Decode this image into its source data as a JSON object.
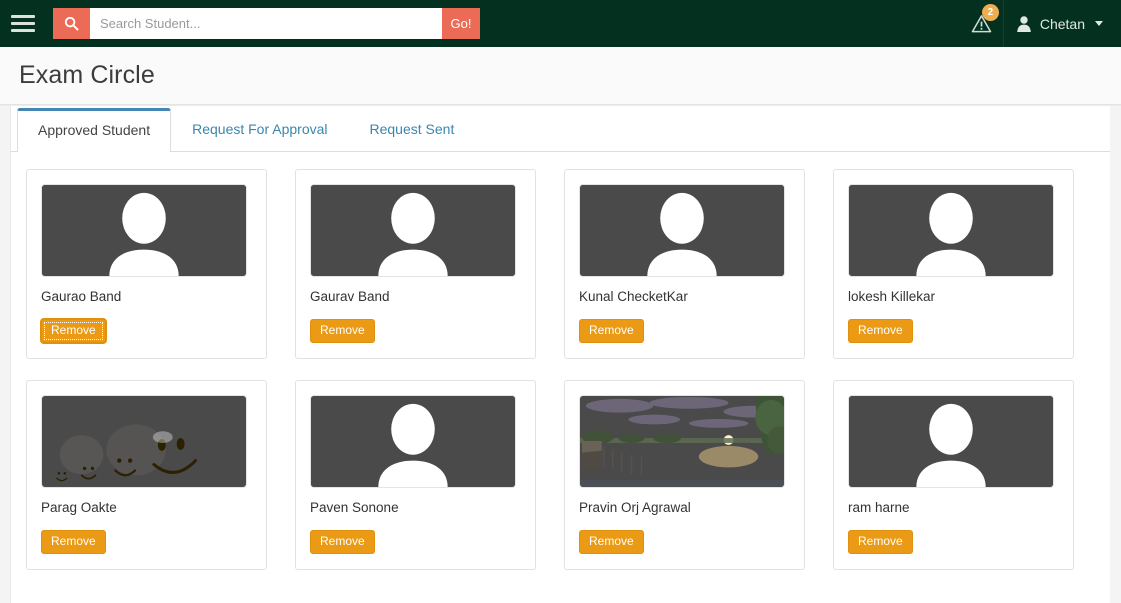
{
  "navbar": {
    "menu_icon": "hamburger-icon",
    "search": {
      "icon": "search-icon",
      "placeholder": "Search Student...",
      "value": "",
      "go_label": "Go!"
    },
    "alerts": {
      "icon": "warning-triangle-icon",
      "count": "2"
    },
    "user": {
      "icon": "user-icon",
      "name": "Chetan",
      "caret": "chevron-down-icon"
    },
    "colors": {
      "navbar_bg": "#04311f",
      "accent": "#ec6b56",
      "badge": "#f0ad4e"
    }
  },
  "page": {
    "title": "Exam Circle"
  },
  "tabs": [
    {
      "label": "Approved Student",
      "active": true
    },
    {
      "label": "Request For Approval",
      "active": false
    },
    {
      "label": "Request Sent",
      "active": false
    }
  ],
  "students": [
    {
      "name": "Gaurao Band",
      "remove_label": "Remove",
      "avatar": "placeholder",
      "focused": true
    },
    {
      "name": "Gaurav Band",
      "remove_label": "Remove",
      "avatar": "placeholder",
      "focused": false
    },
    {
      "name": "Kunal ChecketKar",
      "remove_label": "Remove",
      "avatar": "placeholder",
      "focused": false
    },
    {
      "name": "lokesh Killekar",
      "remove_label": "Remove",
      "avatar": "placeholder",
      "focused": false
    },
    {
      "name": "Parag Oakte",
      "remove_label": "Remove",
      "avatar": "smileys",
      "focused": false
    },
    {
      "name": "Paven Sonone",
      "remove_label": "Remove",
      "avatar": "placeholder",
      "focused": false
    },
    {
      "name": "Pravin Orj Agrawal",
      "remove_label": "Remove",
      "avatar": "sunset",
      "focused": false
    },
    {
      "name": "ram harne",
      "remove_label": "Remove",
      "avatar": "placeholder",
      "focused": false
    }
  ],
  "theme": {
    "remove_button": "#ea9a14",
    "tab_link": "#3a87ad",
    "tab_active_border": "#4486b4"
  }
}
